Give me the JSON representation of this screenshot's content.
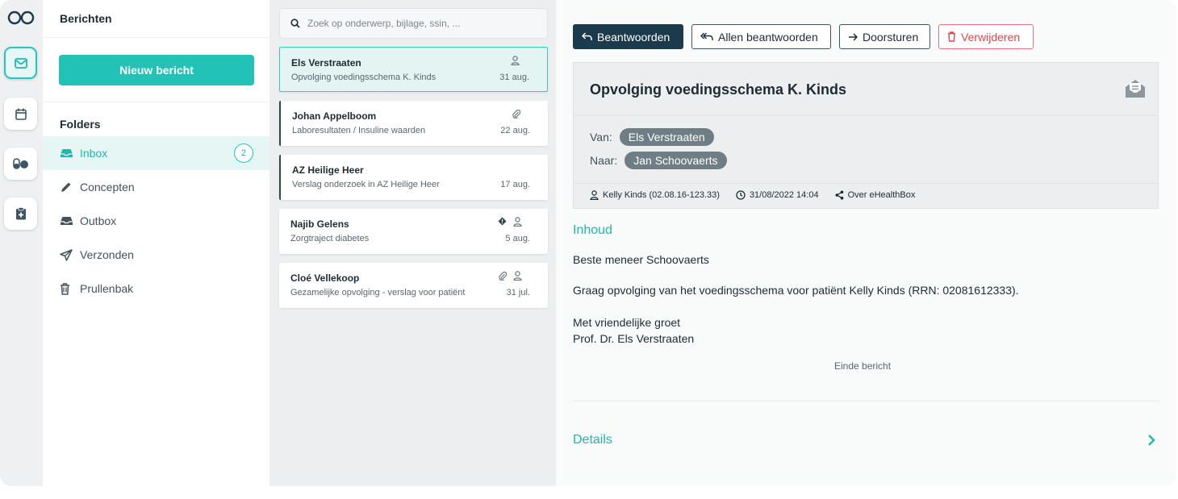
{
  "sidebar": {
    "title": "Berichten",
    "new_button": "Nieuw bericht",
    "folders_heading": "Folders",
    "folders": [
      {
        "label": "Inbox",
        "icon": "inbox-icon",
        "badge": "2"
      },
      {
        "label": "Concepten",
        "icon": "pencil-icon"
      },
      {
        "label": "Outbox",
        "icon": "outbox-icon"
      },
      {
        "label": "Verzonden",
        "icon": "send-icon"
      },
      {
        "label": "Prullenbak",
        "icon": "trash-icon"
      }
    ]
  },
  "search": {
    "placeholder": "Zoek op onderwerp, bijlage, ssin, ..."
  },
  "messages": [
    {
      "sender": "Els Verstraaten",
      "subject": "Opvolging voedingsschema K. Kinds",
      "date": "31 aug."
    },
    {
      "sender": "Johan Appelboom",
      "subject": "Laboresultaten / Insuline waarden",
      "date": "22 aug."
    },
    {
      "sender": "AZ Heilige Heer",
      "subject": "Verslag onderzoek in AZ Heilige Heer",
      "date": "17 aug."
    },
    {
      "sender": "Najib Gelens",
      "subject": "Zorgtraject diabetes",
      "date": "5 aug."
    },
    {
      "sender": "Cloé Vellekoop",
      "subject": "Gezamelijke opvolging - verslag voor patiënt",
      "date": "31 jul."
    }
  ],
  "toolbar": {
    "reply": "Beantwoorden",
    "reply_all": "Allen beantwoorden",
    "forward": "Doorsturen",
    "delete": "Verwijderen"
  },
  "message": {
    "subject": "Opvolging voedingsschema K. Kinds",
    "from_label": "Van:",
    "from": "Els Verstraaten",
    "to_label": "Naar:",
    "to": "Jan Schoovaerts",
    "patient": "Kelly Kinds (02.08.16-123.33)",
    "datetime": "31/08/2022 14:04",
    "about": "Over eHealthBox",
    "content_heading": "Inhoud",
    "greeting": "Beste meneer Schoovaerts",
    "body": "Graag opvolging van het voedingsschema voor patiënt Kelly Kinds (RRN: 02081612333).",
    "closing": "Met vriendelijke groet",
    "signature": "Prof. Dr. Els Verstraaten",
    "end_label": "Einde bericht",
    "details_label": "Details"
  },
  "colors": {
    "accent": "#22c3b6",
    "primary_dark": "#1b3a4b",
    "danger": "#e0474c"
  }
}
